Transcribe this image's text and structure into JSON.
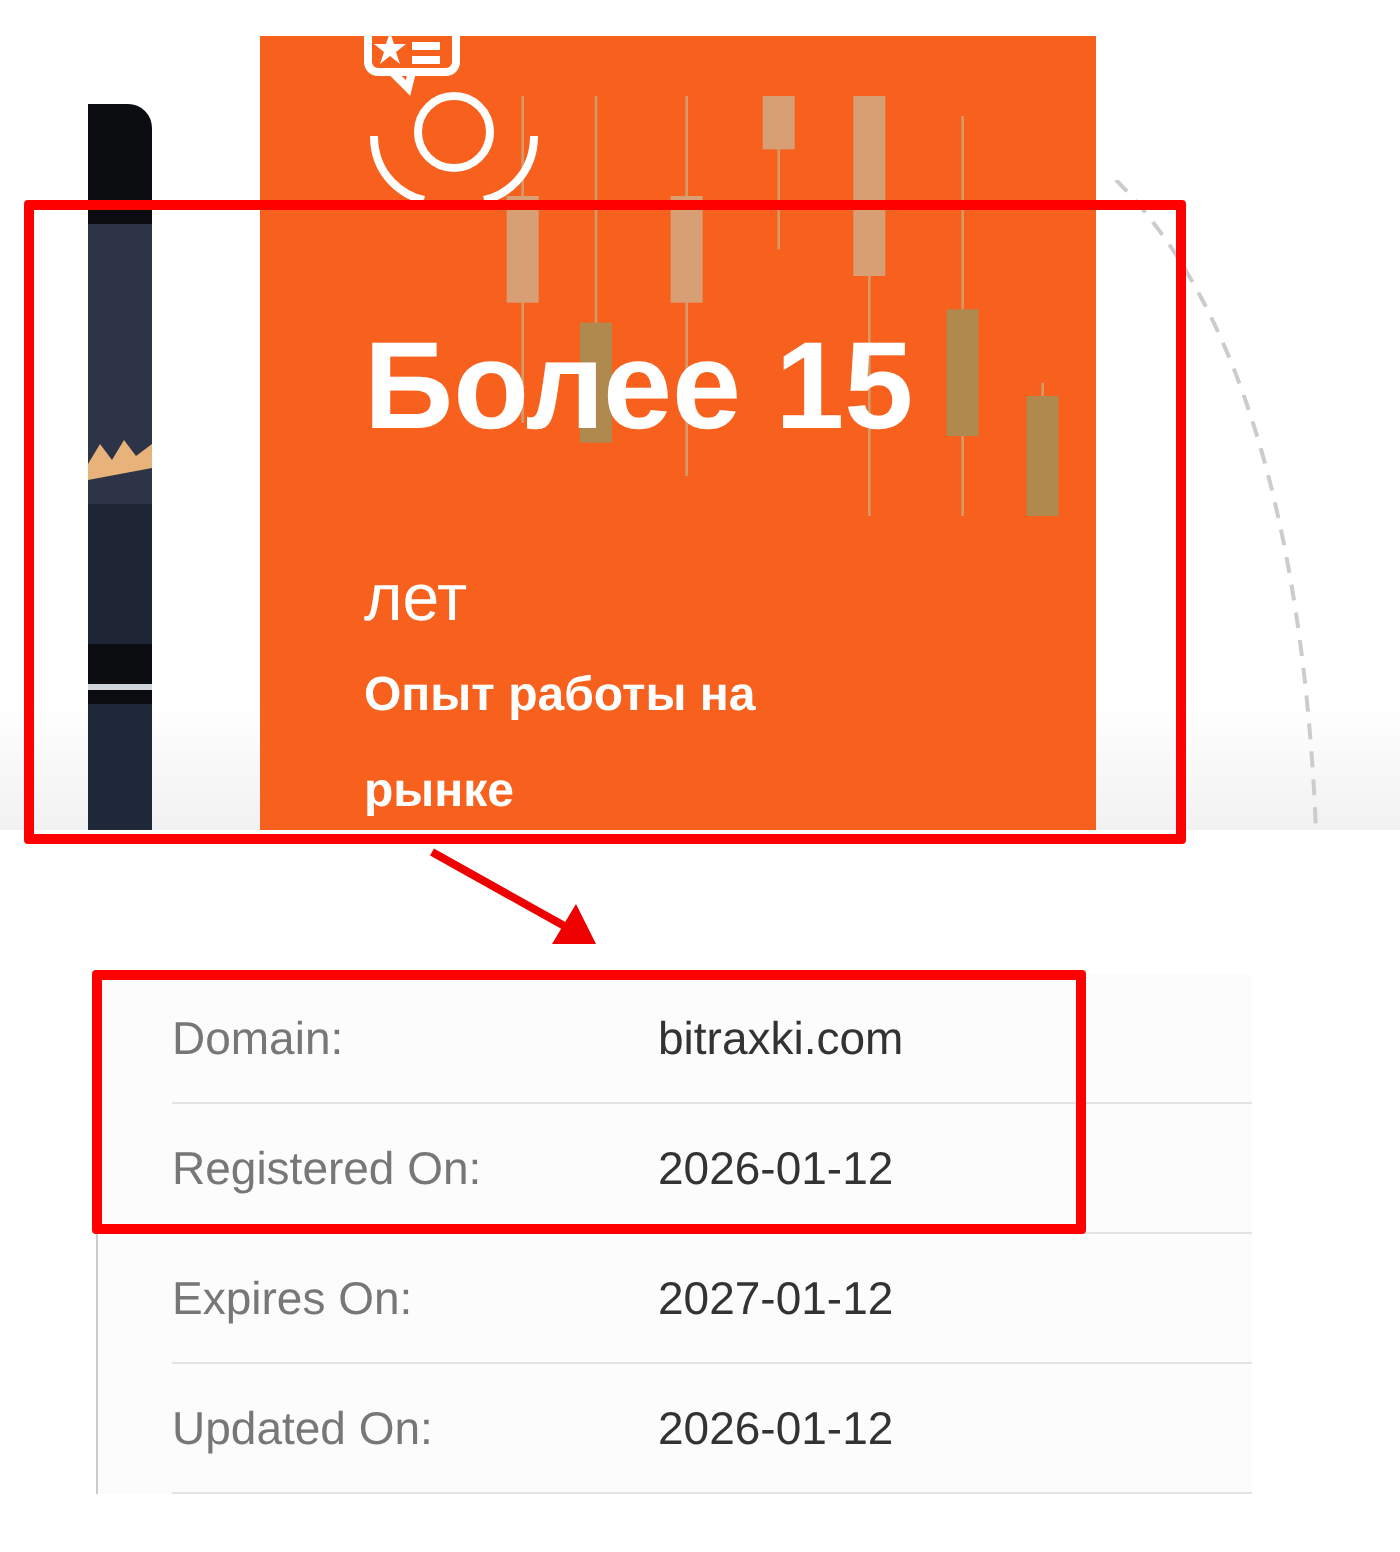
{
  "hero_card": {
    "title": "Более 15",
    "unit": "лет",
    "caption": "Опыт работы на рынке",
    "highlighted": true
  },
  "whois": {
    "rows": [
      {
        "label": "Domain:",
        "value": "bitraxki.com",
        "highlighted": true
      },
      {
        "label": "Registered On:",
        "value": "2026-01-12",
        "highlighted": true
      },
      {
        "label": "Expires On:",
        "value": "2027-01-12",
        "highlighted": false
      },
      {
        "label": "Updated On:",
        "value": "2026-01-12",
        "highlighted": false
      }
    ]
  }
}
